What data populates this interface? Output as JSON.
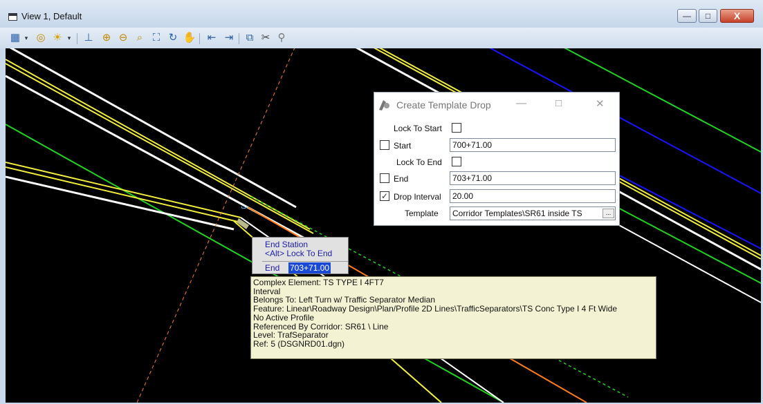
{
  "window": {
    "title": "View 1, Default",
    "minimize_glyph": "—",
    "maximize_glyph": "□",
    "close_glyph": "X"
  },
  "toolbar": {
    "items": [
      {
        "name": "view-attributes-icon",
        "glyph": "▦"
      },
      {
        "name": "dropdown-arrow-icon",
        "glyph": "▾"
      },
      {
        "name": "display-style-icon",
        "glyph": "◎"
      },
      {
        "name": "lighting-icon",
        "glyph": "☀"
      },
      {
        "name": "dropdown-arrow-icon",
        "glyph": "▾"
      },
      {
        "name": "update-view-icon",
        "glyph": "⊥"
      },
      {
        "name": "zoom-in-icon",
        "glyph": "⊕"
      },
      {
        "name": "zoom-out-icon",
        "glyph": "⊖"
      },
      {
        "name": "window-area-icon",
        "glyph": "⌕"
      },
      {
        "name": "fit-view-icon",
        "glyph": "⛶"
      },
      {
        "name": "rotate-view-icon",
        "glyph": "↻"
      },
      {
        "name": "pan-view-icon",
        "glyph": "✋"
      },
      {
        "name": "view-previous-icon",
        "glyph": "⇤"
      },
      {
        "name": "view-next-icon",
        "glyph": "⇥"
      },
      {
        "name": "copy-view-icon",
        "glyph": "⧉"
      },
      {
        "name": "clip-volume-icon",
        "glyph": "✂"
      },
      {
        "name": "clip-mask-icon",
        "glyph": "⚲"
      }
    ]
  },
  "dialog": {
    "title": "Create Template Drop",
    "icon": "template-drop-icon",
    "rows": {
      "lock_to_start_label": "Lock To Start",
      "start_label": "Start",
      "start_value": "700+71.00",
      "lock_to_end_label": "Lock To End",
      "end_label": "End",
      "end_value": "703+71.00",
      "drop_interval_label": "Drop Interval",
      "drop_interval_value": "20.00",
      "template_label": "Template",
      "template_value": "Corridor Templates\\SR61 inside TS",
      "browse_label": "...",
      "checkmark": "✓"
    }
  },
  "cursor_prompt": {
    "line1": "End Station",
    "line2": "<Alt> Lock To End",
    "field_label": "End",
    "field_value": "703+71.00"
  },
  "tooltip": {
    "lines": [
      "Complex Element: TS TYPE I 4FT7",
      "Interval",
      "Belongs To: Left Turn w/ Traffic Separator Median",
      "Feature: Linear\\Roadway Design\\Plan/Profile 2D Lines\\TrafficSeparators\\TS Conc Type I 4 Ft Wide",
      "No Active Profile",
      "Referenced By Corridor: SR61 \\ Line",
      "Level:  TrafSeparator",
      "Ref: 5 (DSGNRD01.dgn)"
    ]
  },
  "colors": {
    "canvas": "#000000",
    "white_line": "#ffffff",
    "yellow_line": "#f2ef3a",
    "green_line": "#1fd21f",
    "blue_line": "#1515ff",
    "orange_line": "#ff7a18"
  }
}
